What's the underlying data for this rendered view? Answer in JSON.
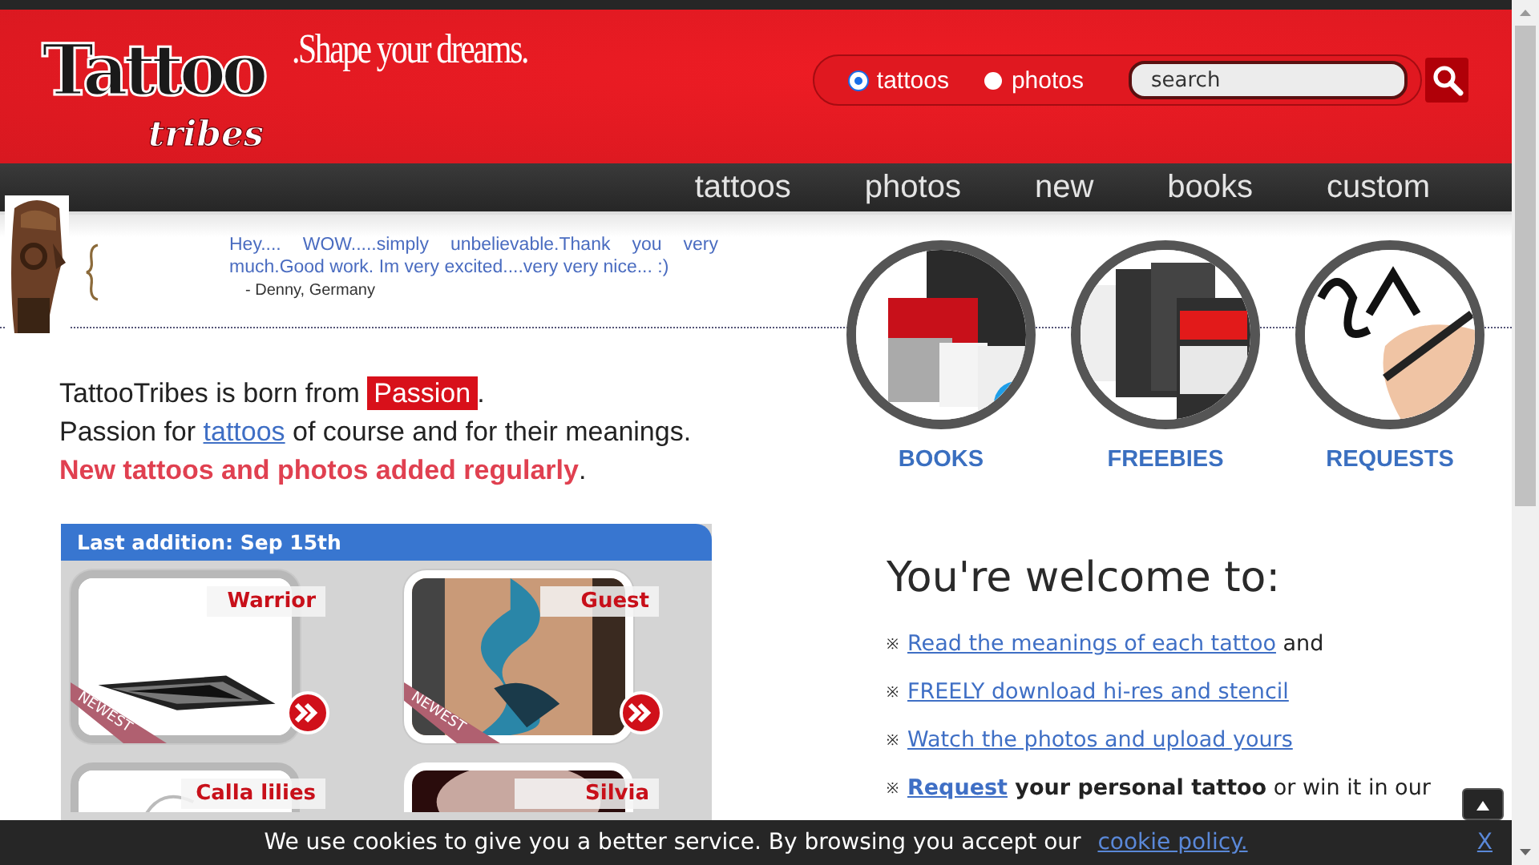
{
  "header": {
    "logo": {
      "main": "Tattoo",
      "sub": "tribes"
    },
    "tagline": ".Shape your dreams.",
    "search": {
      "scopes": [
        {
          "label": "tattoos",
          "selected": true
        },
        {
          "label": "photos",
          "selected": false
        }
      ],
      "placeholder": "search"
    }
  },
  "nav": [
    "tattoos",
    "photos",
    "new",
    "books",
    "custom"
  ],
  "testimonial": {
    "quote": "Hey.... WOW.....simply unbelievable.Thank you very much.Good work. Im very excited....very very nice... :)",
    "author": "- Denny, Germany"
  },
  "intro": [
    [
      {
        "kind": "plain",
        "text": "TattooTribes is born from "
      },
      {
        "kind": "highlight",
        "text": "Passion"
      },
      {
        "kind": "plain",
        "text": "."
      }
    ],
    [
      {
        "kind": "plain",
        "text": "Passion for "
      },
      {
        "kind": "link",
        "text": "tattoos"
      },
      {
        "kind": "plain",
        "text": " of course and for their meanings."
      }
    ],
    [
      {
        "kind": "emphasis",
        "text": "New tattoos and photos added regularly"
      },
      {
        "kind": "plain",
        "text": "."
      }
    ]
  ],
  "gallery": {
    "title": "Last addition: Sep 15th",
    "items": [
      {
        "title": "Warrior",
        "newest": true,
        "badge": "NEWEST"
      },
      {
        "title": "Guest",
        "newest": true,
        "badge": "NEWEST"
      },
      {
        "title": "Calla lilies",
        "newest": false
      },
      {
        "title": "Silvia",
        "newest": false
      }
    ]
  },
  "features": [
    {
      "label": "BOOKS",
      "kind": "books"
    },
    {
      "label": "FREEBIES",
      "kind": "freebies"
    },
    {
      "label": "REQUESTS",
      "kind": "requests"
    }
  ],
  "welcome": {
    "title": "You're welcome to:",
    "items": [
      {
        "bullet": "※",
        "segments": [
          {
            "kind": "link",
            "text": "Read the meanings of each tattoo"
          },
          {
            "kind": "plain",
            "text": " and"
          }
        ]
      },
      {
        "bullet": "※",
        "segments": [
          {
            "kind": "link",
            "text": "FREELY download hi-res and stencil"
          }
        ]
      },
      {
        "bullet": "※",
        "segments": [
          {
            "kind": "link",
            "text": "Watch the photos and upload yours"
          }
        ]
      },
      {
        "bullet": "※",
        "segments": [
          {
            "kind": "bold-link",
            "text": "Request"
          },
          {
            "kind": "bold",
            "text": " your personal tattoo"
          },
          {
            "kind": "plain",
            "text": " or win it in our"
          }
        ]
      }
    ]
  },
  "cookie": {
    "text": "We use cookies to give you a better service. By browsing you accept our ",
    "link": "cookie policy.",
    "close": "X"
  }
}
